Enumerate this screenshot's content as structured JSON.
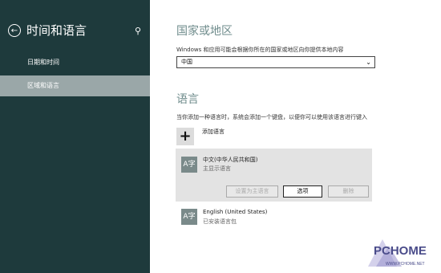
{
  "sidebar": {
    "title": "时间和语言",
    "items": [
      {
        "label": "日期和时间"
      },
      {
        "label": "区域和语言"
      }
    ]
  },
  "region": {
    "heading": "国家或地区",
    "description": "Windows 和应用可能会根据你所在的国家或地区向你提供本地内容",
    "selected": "中国"
  },
  "language": {
    "heading": "语言",
    "description": "当你添加一种语言时，系统会添加一个键盘，以便你可以使用该语言进行键入",
    "add_label": "添加语言",
    "items": [
      {
        "icon": "A字",
        "name": "中文(中华人民共和国)",
        "status": "主显示语言"
      },
      {
        "icon": "A字",
        "name": "English (United States)",
        "status": "已安装语言包"
      }
    ],
    "buttons": {
      "set_primary": "设置为主语言",
      "options": "选项",
      "remove": "删除"
    }
  },
  "watermark": {
    "text": "PCHOME",
    "url": "WWW.PCHOME.NET"
  }
}
